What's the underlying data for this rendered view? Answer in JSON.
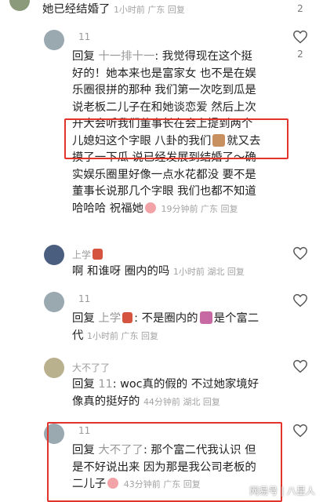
{
  "top_comment": {
    "text": "她已经结婚了",
    "meta": "1小时前 广东 回复",
    "likes": "2"
  },
  "replies": [
    {
      "author": "11",
      "reply_to": "十一排十一",
      "line1": "回复 十一排十一: 我觉得现在这个挺",
      "lines": [
        "好的！她本来也是富家女 也不是在娱",
        "乐圈很拼的那种 我们第一次吃到瓜是",
        "说老板二儿子在和她谈恋爱 然后上次",
        "开大会听我们董事长在会上提到两个",
        "儿媳妇这个字眼 八卦的我们",
        "摸了一下瓜 说已经发展到结婚了～确",
        "实娱乐圈里好像一点水花都没 要不是",
        "董事长说那几个字眼 我们也都不知道",
        "哈哈哈 祝福她"
      ],
      "line5_tail": "就又去",
      "meta": "19分钟前 广东 回复",
      "likes": "2"
    },
    {
      "author": "上学",
      "text": "啊 和谁呀 圈内的吗",
      "meta": "1小时前 湖北 回复"
    },
    {
      "author": "11",
      "reply_to": "上学",
      "text_a": ": 不是圈内的",
      "text_b": "是个富二",
      "text_c": "代",
      "meta": "1小时前 广东 回复"
    },
    {
      "author": "大不了了",
      "reply_to": "11",
      "text_a": ": woc真的假的 不过她家境好",
      "text_b": "像真的挺好的",
      "meta": "44分钟前 湖北 回复"
    },
    {
      "author": "11",
      "reply_to": "大不了了",
      "text_a": ": 那个富二代我认识 但",
      "text_b": "是不好说出来 因为那是我公司老板的",
      "text_c": "二儿子",
      "meta": "43分钟前 广东 回复"
    }
  ],
  "labels": {
    "reply": "回复"
  },
  "watermark": "网易号 | 八星人",
  "colors": {
    "highlight": "#e2342a",
    "meta": "#a3a3a3"
  }
}
